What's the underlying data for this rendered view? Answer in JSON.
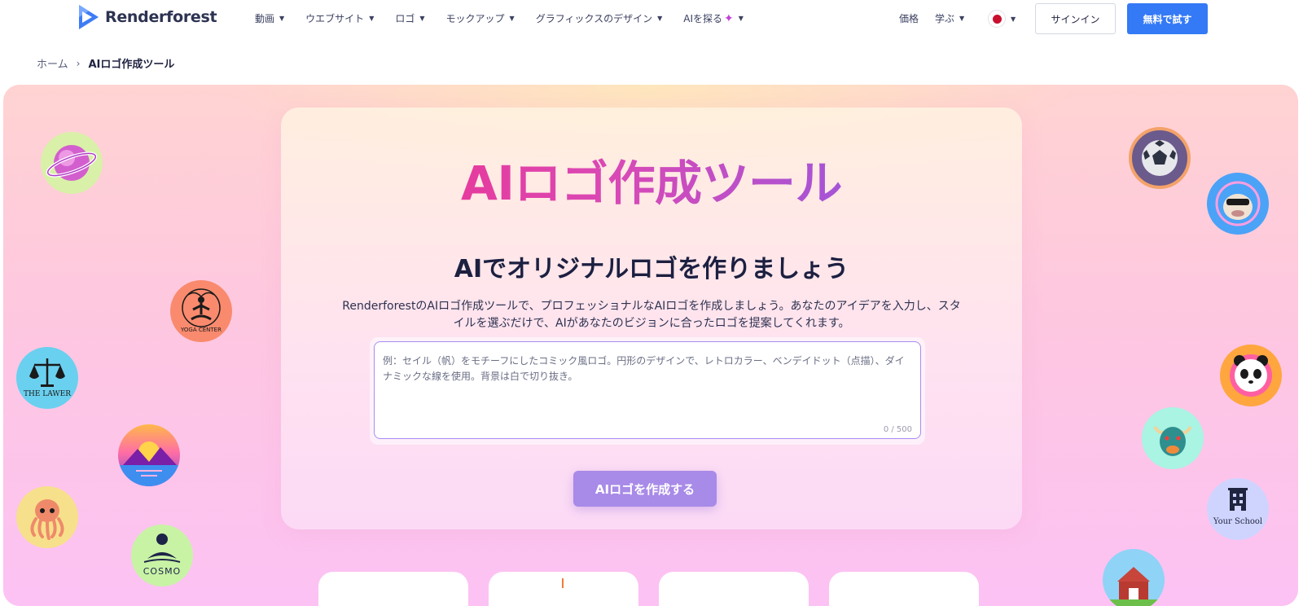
{
  "header": {
    "brand": "Renderforest",
    "nav": [
      {
        "label": "動画"
      },
      {
        "label": "ウエブサイト"
      },
      {
        "label": "ロゴ"
      },
      {
        "label": "モックアップ"
      },
      {
        "label": "グラフィックスのデザイン"
      },
      {
        "label": "AIを探る"
      }
    ],
    "pricing": "価格",
    "learn": "学ぶ",
    "signin": "サインイン",
    "trial": "無料で試す",
    "colors": {
      "primary": "#3479f6",
      "flag": "#c8102e"
    }
  },
  "breadcrumb": {
    "home": "ホーム",
    "current": "AIロゴ作成ツール"
  },
  "hero": {
    "title": "AIロゴ作成ツール",
    "subtitle": "AIでオリジナルロゴを作りましょう",
    "description": "RenderforestのAIロゴ作成ツールで、プロフェッショナルなAIロゴを作成しましょう。あなたのアイデアを入力し、スタイルを選ぶだけで、AIがあなたのビジョンに合ったロゴを提案してくれます。",
    "input_placeholder": "例：セイル（帆）をモチーフにしたコミック風ロゴ。円形のデザインで、レトロカラー、ベンデイドット（点描）、ダイナミックな線を使用。背景は白で切り抜き。",
    "counter": "0 / 500",
    "create_button": "AIロゴを作成する",
    "title_gradient": [
      "#f52b83",
      "#d949b6",
      "#7b5df1"
    ],
    "button_color": "#a88ae8"
  },
  "sample_logos": {
    "yoga": "YOGA CENTER",
    "lawyer": "THE LAWER",
    "cosmo": "COSMO",
    "school": "Your School"
  }
}
